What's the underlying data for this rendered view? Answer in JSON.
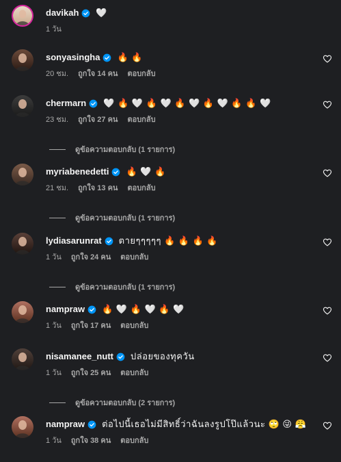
{
  "comments": [
    {
      "username": "davikah",
      "verified": true,
      "text": "🤍",
      "time": "1 วัน",
      "likes": "",
      "reply": "",
      "replies_label": "",
      "story_ring": true,
      "show_like": false
    },
    {
      "username": "sonyasingha",
      "verified": true,
      "text": "🔥 🔥",
      "time": "20 ชม.",
      "likes": "ถูกใจ 14 คน",
      "reply": "ตอบกลับ",
      "replies_label": "",
      "story_ring": false,
      "show_like": true
    },
    {
      "username": "chermarn",
      "verified": true,
      "text": "🤍 🔥 🤍 🔥 🤍 🔥 🤍 🔥 🤍 🔥 🔥 🤍",
      "time": "23 ชม.",
      "likes": "ถูกใจ 27 คน",
      "reply": "ตอบกลับ",
      "replies_label": "ดูข้อความตอบกลับ (1 รายการ)",
      "story_ring": false,
      "show_like": true
    },
    {
      "username": "myriabenedetti",
      "verified": true,
      "text": "🔥 🤍 🔥",
      "time": "21 ชม.",
      "likes": "ถูกใจ 13 คน",
      "reply": "ตอบกลับ",
      "replies_label": "ดูข้อความตอบกลับ (1 รายการ)",
      "story_ring": false,
      "show_like": true
    },
    {
      "username": "lydiasarunrat",
      "verified": true,
      "text": "ตายๆๆๆๆๆ 🔥 🔥 🔥 🔥",
      "time": "1 วัน",
      "likes": "ถูกใจ 24 คน",
      "reply": "ตอบกลับ",
      "replies_label": "ดูข้อความตอบกลับ (1 รายการ)",
      "story_ring": false,
      "show_like": true
    },
    {
      "username": "nampraw",
      "verified": true,
      "text": "🔥 🤍 🔥 🤍 🔥 🤍",
      "time": "1 วัน",
      "likes": "ถูกใจ 17 คน",
      "reply": "ตอบกลับ",
      "replies_label": "",
      "story_ring": false,
      "show_like": true
    },
    {
      "username": "nisamanee_nutt",
      "verified": true,
      "text": "ปล่อยของทุควัน",
      "time": "1 วัน",
      "likes": "ถูกใจ 25 คน",
      "reply": "ตอบกลับ",
      "replies_label": "ดูข้อความตอบกลับ (2 รายการ)",
      "story_ring": false,
      "show_like": true
    },
    {
      "username": "nampraw",
      "verified": true,
      "text": "ต่อไปนี้เธอไม่มีสิทธิ์ว่าฉันลงรูปโป๊แล้วนะ 🙄 😜 😤",
      "time": "1 วัน",
      "likes": "ถูกใจ 38 คน",
      "reply": "ตอบกลับ",
      "replies_label": "",
      "story_ring": false,
      "show_like": true
    }
  ],
  "colors": {
    "background": "#1e1f22",
    "text": "#f5f5f5",
    "muted": "#a8a8a8",
    "verified": "#0095f6"
  },
  "icons": {
    "verified": "verified-badge-icon",
    "like": "heart-outline-icon"
  }
}
